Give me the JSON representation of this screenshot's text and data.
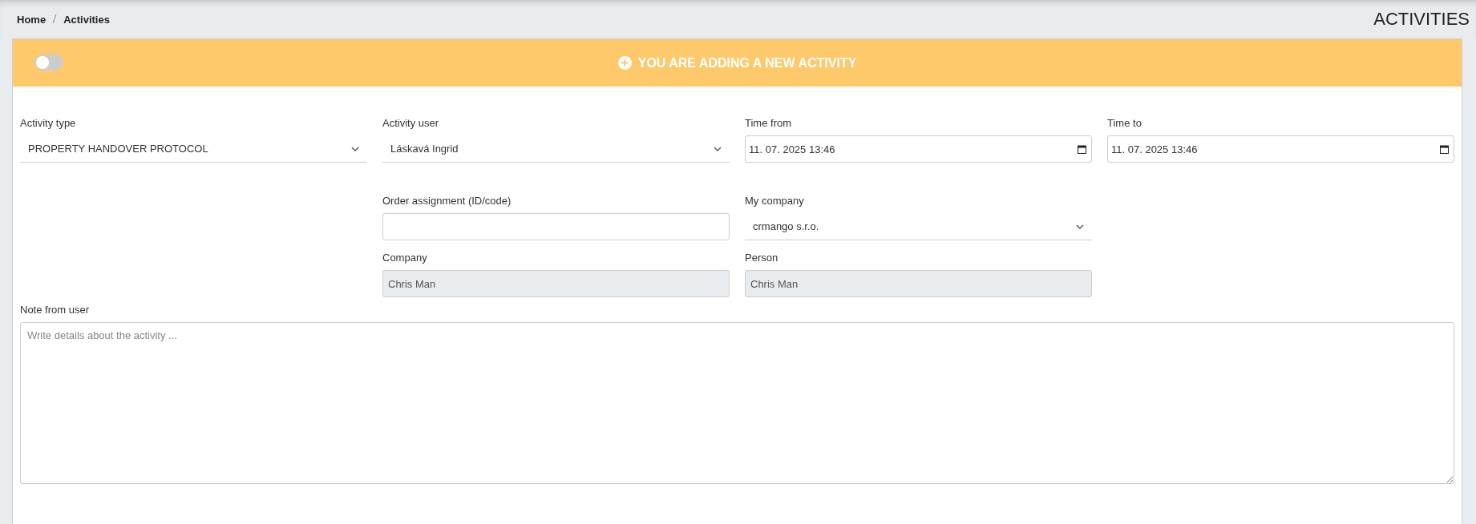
{
  "breadcrumb": [
    {
      "label": "Home"
    },
    {
      "label": "Activities"
    }
  ],
  "page_title": "ACTIVITIES",
  "banner": {
    "toggle": {
      "on": false
    },
    "text": "YOU ARE ADDING A NEW ACTIVITY"
  },
  "fields": [
    {
      "kind": "select",
      "label": "Activity type",
      "value": "PROPERTY HANDOVER PROTOCOL"
    },
    {
      "kind": "select",
      "label": "Activity user",
      "value": "Láskavá Ingrid"
    },
    {
      "kind": "datetime",
      "label": "Time from",
      "value": "11. 07. 2025 13:46"
    },
    {
      "kind": "datetime",
      "label": "Time to",
      "value": "11. 07. 2025 13:46"
    }
  ],
  "details": [
    {
      "kind": "text",
      "label": "Order assignment (ID/code)"
    },
    {
      "kind": "select",
      "label": "My company",
      "value": "crmango s.r.o."
    },
    {
      "kind": "readonly",
      "label": "Company",
      "value": "Chris Man"
    },
    {
      "kind": "readonly",
      "label": "Person",
      "value": "Chris Man"
    }
  ],
  "note": {
    "label": "Note from user",
    "placeholder": "Write details about the activity ..."
  }
}
